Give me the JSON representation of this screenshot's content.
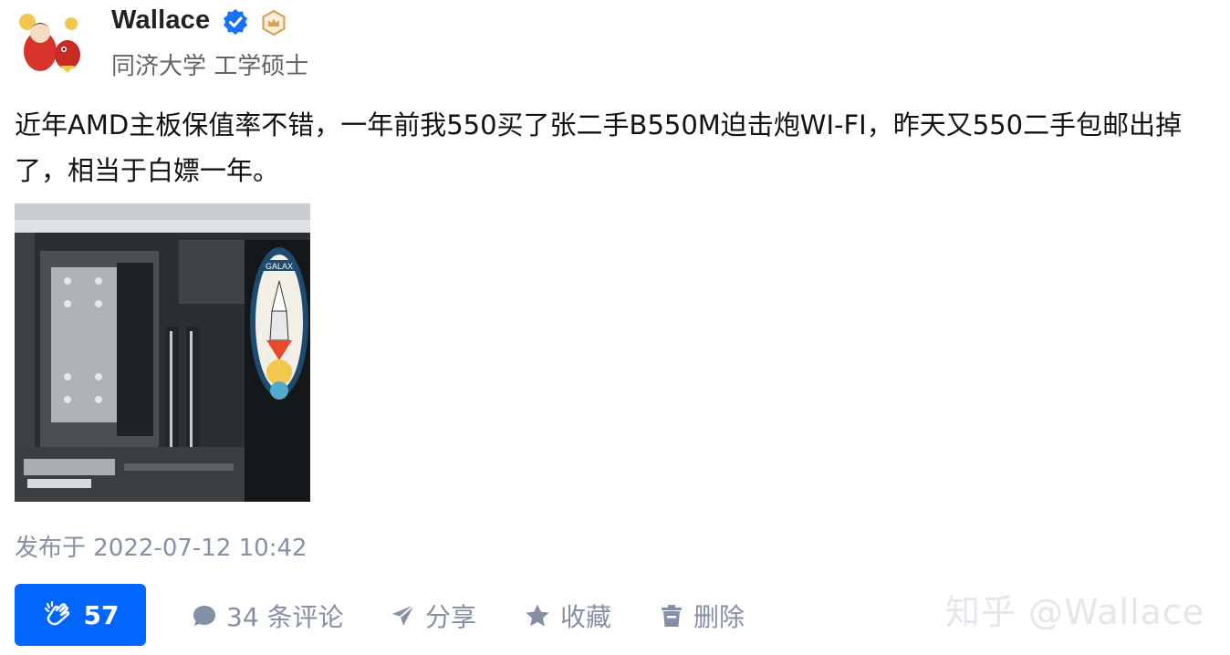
{
  "author": {
    "name": "Wallace",
    "headline": "同济大学 工学硕士"
  },
  "post": {
    "content": "近年AMD主板保值率不错，一年前我550买了张二手B550M迫击炮WI-FI，昨天又550二手包邮出掉了，相当于白嫖一年。",
    "published": "发布于 2022-07-12 10:42"
  },
  "actions": {
    "like_count": "57",
    "comment_label": "34 条评论",
    "share_label": "分享",
    "favorite_label": "收藏",
    "delete_label": "删除"
  },
  "image_sticker": {
    "brand_text": "GALAX"
  },
  "watermark": "知乎 @Wallace",
  "colors": {
    "primary": "#0066ff",
    "muted": "#8590a6",
    "verified": "#1772f6",
    "badge": "#d4a35c"
  },
  "icons": {
    "verified": "verified-check-icon",
    "crown": "crown-badge-icon",
    "like": "clap-icon",
    "comment": "comment-bubble-icon",
    "share": "paper-plane-icon",
    "favorite": "star-icon",
    "delete": "trash-icon"
  }
}
